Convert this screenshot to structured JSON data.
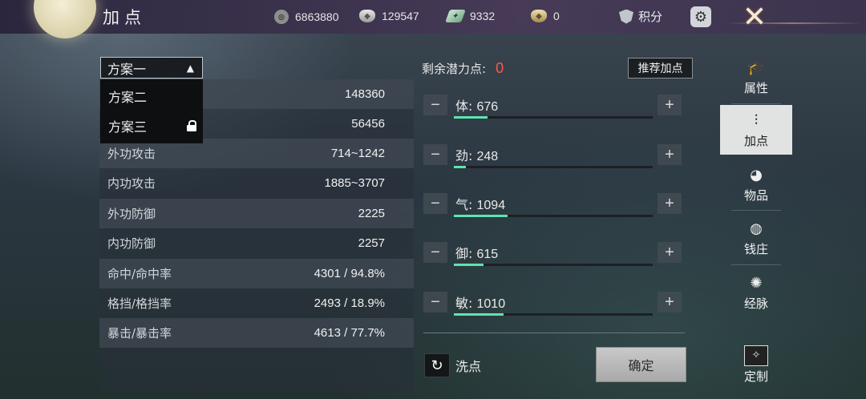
{
  "header": {
    "title": "加点"
  },
  "resources": [
    {
      "icon": "coin-icon",
      "value": "6863880"
    },
    {
      "icon": "silver-ingot-icon",
      "value": "129547"
    },
    {
      "icon": "jade-icon",
      "value": "9332"
    },
    {
      "icon": "gold-ingot-icon",
      "value": "0"
    }
  ],
  "points_label": "积分",
  "plan": {
    "selected": "方案一",
    "options": [
      "方案二",
      "方案三"
    ]
  },
  "stats": [
    {
      "label": "",
      "value": "148360"
    },
    {
      "label": "",
      "value": "56456"
    },
    {
      "label": "外功攻击",
      "value": "714~1242"
    },
    {
      "label": "内功攻击",
      "value": "1885~3707"
    },
    {
      "label": "外功防御",
      "value": "2225"
    },
    {
      "label": "内功防御",
      "value": "2257"
    },
    {
      "label": "命中/命中率",
      "value": "4301 / 94.8%"
    },
    {
      "label": "格挡/格挡率",
      "value": "2493 / 18.9%"
    },
    {
      "label": "暴击/暴击率",
      "value": "4613 / 77.7%"
    }
  ],
  "remaining": {
    "label": "剩余潜力点:",
    "value": "0"
  },
  "recommend_label": "推荐加点",
  "attributes": [
    {
      "name": "体",
      "value": "676",
      "fill": 0.17
    },
    {
      "name": "劲",
      "value": "248",
      "fill": 0.06
    },
    {
      "name": "气",
      "value": "1094",
      "fill": 0.27
    },
    {
      "name": "御",
      "value": "615",
      "fill": 0.15
    },
    {
      "name": "敏",
      "value": "1010",
      "fill": 0.25
    }
  ],
  "wash_label": "洗点",
  "confirm_label": "确定",
  "nav": [
    {
      "label": "属性",
      "icon": "scholar-icon"
    },
    {
      "label": "加点",
      "icon": "sliders-icon"
    },
    {
      "label": "物品",
      "icon": "bag-icon"
    },
    {
      "label": "钱庄",
      "icon": "money-pouch-icon"
    },
    {
      "label": "经脉",
      "icon": "meridian-icon"
    },
    {
      "label": "定制",
      "icon": "magic-wand-icon"
    }
  ],
  "colors": {
    "accent_bar": "#5fe3b0",
    "remaining_value": "#ff5a4a",
    "active_tab": "#ebebeb"
  }
}
